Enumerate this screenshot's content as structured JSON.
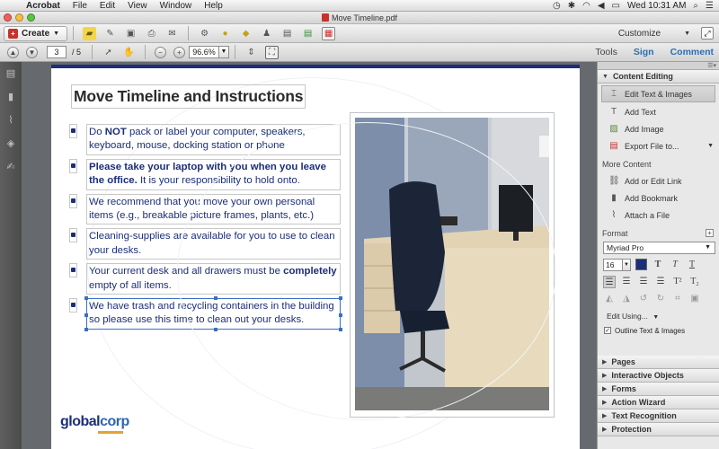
{
  "menubar": {
    "app": "Acrobat",
    "items": [
      "File",
      "Edit",
      "View",
      "Window",
      "Help"
    ],
    "clock": "Wed 10:31 AM"
  },
  "window": {
    "title": "Move Timeline.pdf"
  },
  "toolbar": {
    "create": "Create",
    "customize": "Customize"
  },
  "nav": {
    "page": "3",
    "total": "/ 5",
    "zoom": "96.6%"
  },
  "tabs": {
    "tools": "Tools",
    "sign": "Sign",
    "comment": "Comment"
  },
  "document": {
    "title": "Move Timeline and Instructions",
    "bullets": [
      {
        "pre": "Do ",
        "bold": "NOT",
        "post": " pack or label your computer, speakers, keyboard, mouse, docking station or phone"
      },
      {
        "pre": "",
        "bold": "Please take your laptop with you when you leave the office.",
        "post": "  It is your responsibility to hold onto."
      },
      {
        "pre": "We recommend that you move your own personal items (e.g., breakable picture frames, plants, etc.)",
        "bold": "",
        "post": ""
      },
      {
        "pre": "Cleaning-supplies are available for you to use to clean your desks.",
        "bold": "",
        "post": ""
      },
      {
        "pre": "Your current desk and all drawers must be ",
        "bold": "completely",
        "post": " empty of all items."
      },
      {
        "pre": "We have trash and recycling containers in the building so please use this time to clean out your desks.",
        "bold": "",
        "post": ""
      }
    ],
    "logo_a": "global",
    "logo_b": "corp"
  },
  "panel": {
    "content_editing": "Content Editing",
    "edit_text_images": "Edit Text & Images",
    "add_text": "Add Text",
    "add_image": "Add Image",
    "export_file": "Export File to...",
    "more_content": "More Content",
    "add_edit_link": "Add or Edit Link",
    "add_bookmark": "Add Bookmark",
    "attach_file": "Attach a File",
    "format": "Format",
    "font": "Myriad Pro",
    "size": "16",
    "edit_using": "Edit Using...",
    "outline": "Outline Text & Images",
    "sections": [
      "Pages",
      "Interactive Objects",
      "Forms",
      "Action Wizard",
      "Text Recognition",
      "Protection"
    ]
  },
  "colors": {
    "accent": "#1c2e7a",
    "link": "#2d6fb0"
  }
}
